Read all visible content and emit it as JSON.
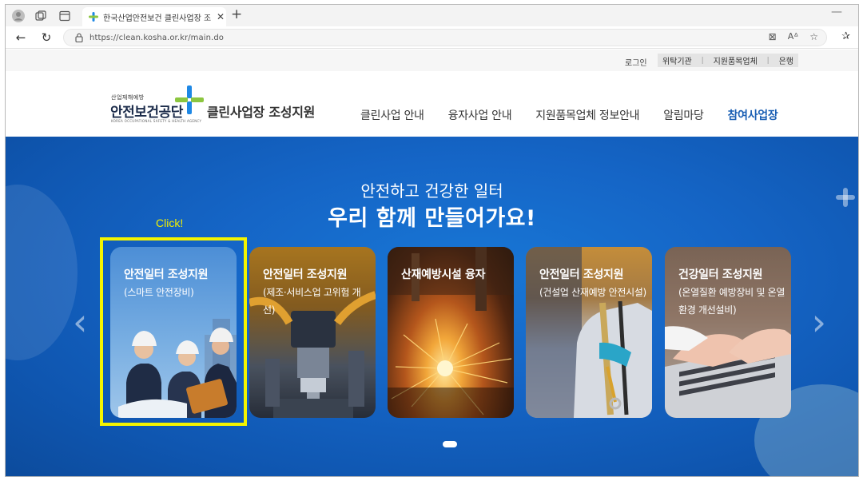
{
  "browser": {
    "tab_title": "한국산업안전보건 클린사업장 조",
    "url": "https://clean.kosha.or.kr/main.do"
  },
  "utility": {
    "login": "로그인",
    "links": [
      "위탁기관",
      "지원품목업체",
      "은행"
    ]
  },
  "logo": {
    "small": "산업재해예방",
    "main": "안전보건공단",
    "eng": "KOREA OCCUPATIONAL SAFETY & HEALTH AGENCY",
    "subtitle": "클린사업장 조성지원"
  },
  "nav": [
    "클린사업 안내",
    "융자사업 안내",
    "지원품목업체 정보안내",
    "알림마당",
    "참여사업장"
  ],
  "hero": {
    "line1": "안전하고 건강한 일터",
    "line2": "우리 함께 만들어가요!",
    "annotation": "Click!"
  },
  "cards": [
    {
      "title": "안전일터 조성지원",
      "desc": "(스마트 안전장비)"
    },
    {
      "title": "안전일터 조성지원",
      "desc": "(제조·서비스업 고위험 개선)"
    },
    {
      "title": "산재예방시설 융자",
      "desc": ""
    },
    {
      "title": "안전일터 조성지원",
      "desc": "(건설업 산재예방 안전시설)"
    },
    {
      "title": "건강일터 조성지원",
      "desc": "(온열질환 예방장비 및 온열환경 개선설비)"
    }
  ],
  "colors": {
    "hero_blue": "#1565c6",
    "nav_active": "#1a5fb4",
    "highlight": "#f4f400",
    "logo_green": "#8cc63f",
    "logo_blue": "#1e88e5"
  }
}
